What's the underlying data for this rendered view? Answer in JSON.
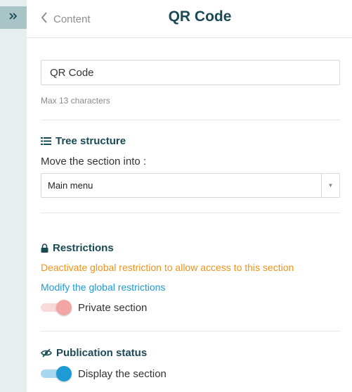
{
  "sidebar": {
    "expand_icon": "double-chevron-right-icon"
  },
  "header": {
    "back_label": "Content",
    "back_icon": "chevron-left-icon",
    "title": "QR Code"
  },
  "name_field": {
    "value": "QR Code",
    "hint": "Max 13 characters"
  },
  "tree_structure": {
    "title": "Tree structure",
    "icon": "list-icon",
    "move_label": "Move the section into :",
    "selected_option": "Main menu"
  },
  "restrictions": {
    "title": "Restrictions",
    "icon": "lock-icon",
    "warning": "Deactivate global restriction to allow access to this section",
    "modify_link": "Modify the global restrictions",
    "private_label": "Private section",
    "private_enabled": false
  },
  "publication": {
    "title": "Publication status",
    "icon": "eye-slash-icon",
    "display_label": "Display the section",
    "display_enabled": true
  },
  "colors": {
    "accent": "#1e9bd6",
    "warning": "#f0921a",
    "title": "#1a4a56",
    "sidebar": "#e6eeee",
    "sidebar_button": "#a9c4c7"
  }
}
